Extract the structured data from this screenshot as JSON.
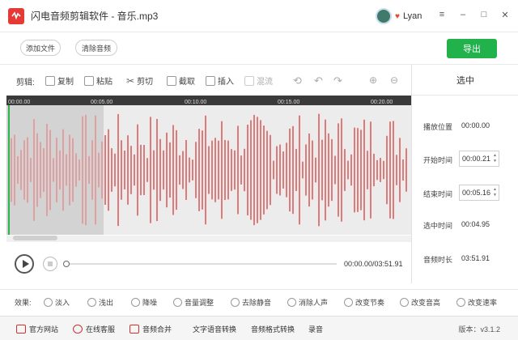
{
  "app": {
    "title": "闪电音频剪辑软件 - 音乐.mp3",
    "user": "Lyan"
  },
  "window": {
    "min": "–",
    "restore": "□",
    "close": "✕",
    "menu": "≡"
  },
  "top": {
    "add_file": "添加文件",
    "clear_audio": "清除音频",
    "export": "导出"
  },
  "edit": {
    "label": "剪辑:",
    "tools": [
      {
        "label": "复制",
        "icon": "copy-icon"
      },
      {
        "label": "粘贴",
        "icon": "paste-icon"
      },
      {
        "label": "剪切",
        "icon": "scissors-icon"
      },
      {
        "label": "截取",
        "icon": "crop-icon"
      },
      {
        "label": "插入",
        "icon": "insert-icon"
      },
      {
        "label": "混流",
        "icon": "mix-icon"
      }
    ]
  },
  "ruler": {
    "ticks": [
      "00:00.00",
      "00:05.00",
      "00:10.00",
      "00:15.00",
      "00:20.00"
    ]
  },
  "right_panel": {
    "title": "选中",
    "play_position_label": "播放位置",
    "play_position": "00:00.00",
    "start_label": "开始时间",
    "start": "00:00.21",
    "end_label": "结束时间",
    "end": "00:05.16",
    "selected_label": "选中时间",
    "selected": "00:04.95",
    "duration_label": "音频时长",
    "duration": "03:51.91"
  },
  "playback": {
    "time": "00:00.00/03:51.91",
    "progress": 0.0
  },
  "effects": {
    "label": "效果:",
    "items": [
      "淡入",
      "浅出",
      "降噪",
      "音量调整",
      "去除静音",
      "消除人声",
      "改变节奏",
      "改变音高",
      "改变速率"
    ]
  },
  "bottom": {
    "items": [
      "官方网站",
      "在线客服",
      "音频合并",
      "文字语音转换",
      "音频格式转换",
      "录音"
    ],
    "version": "版本：v3.1.2"
  },
  "colors": {
    "accent": "#21b24c",
    "waveform": "#d84a4a",
    "brand": "#e53935"
  }
}
